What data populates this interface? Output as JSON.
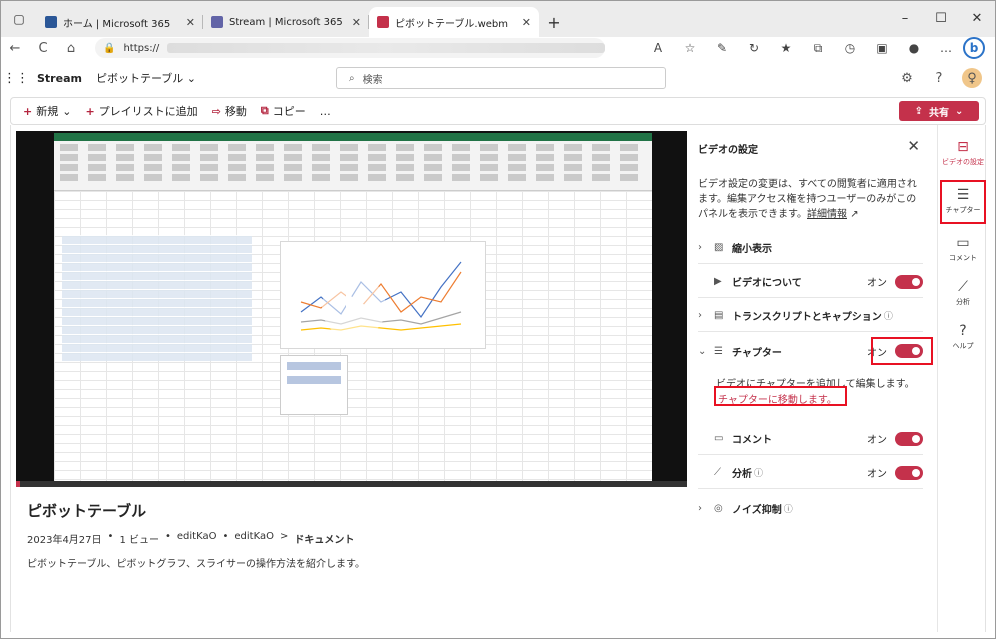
{
  "browser": {
    "tabs": [
      {
        "title": "ホーム | Microsoft 365",
        "favicon": "#2b5797"
      },
      {
        "title": "Stream | Microsoft 365",
        "favicon": "#6264a7"
      },
      {
        "title": "ピボットテーブル.webm",
        "favicon": "#c4314b"
      }
    ],
    "url_prefix": "https://",
    "buttons": {
      "back": "←",
      "reload": "C",
      "home": "⌂",
      "lock": "🔒"
    }
  },
  "stream": {
    "app_name": "Stream",
    "breadcrumb": "ピボットテーブル",
    "search_placeholder": "検索"
  },
  "commands": {
    "new": "新規",
    "add_playlist": "プレイリストに追加",
    "move": "移動",
    "copy": "コピー",
    "more": "…",
    "share": "共有"
  },
  "video": {
    "title": "ピボットテーブル",
    "date": "2023年4月27日",
    "views": "1 ビュー",
    "author": "editKaO",
    "path_user": "editKaO",
    "path_folder": "ドキュメント",
    "description": "ピボットテーブル、ピボットグラフ、スライサーの操作方法を紹介します。"
  },
  "settings": {
    "header": "ビデオの設定",
    "note": "ビデオ設定の変更は、すべての閲覧者に適用されます。編集アクセス権を持つユーザーのみがこのパネルを表示できます。",
    "note_link": "詳細情報",
    "sections": [
      {
        "label": "縮小表示",
        "toggle": false
      },
      {
        "label": "ビデオについて",
        "toggle": true,
        "state": "オン"
      },
      {
        "label": "トランスクリプトとキャプション",
        "toggle": false
      },
      {
        "label": "チャプター",
        "toggle": true,
        "state": "オン"
      },
      {
        "label": "コメント",
        "toggle": true,
        "state": "オン"
      },
      {
        "label": "分析",
        "toggle": true,
        "state": "オン"
      },
      {
        "label": "ノイズ抑制",
        "toggle": false
      }
    ],
    "chapter_note": "ビデオにチャプターを追加して編集します。",
    "chapter_link": "チャプターに移動します。"
  },
  "rail": [
    {
      "label": "ビデオの設定"
    },
    {
      "label": "チャプター"
    },
    {
      "label": "コメント"
    },
    {
      "label": "分析"
    },
    {
      "label": "ヘルプ"
    }
  ],
  "colors": {
    "accent": "#c4314b",
    "highlight": "#e81123"
  }
}
